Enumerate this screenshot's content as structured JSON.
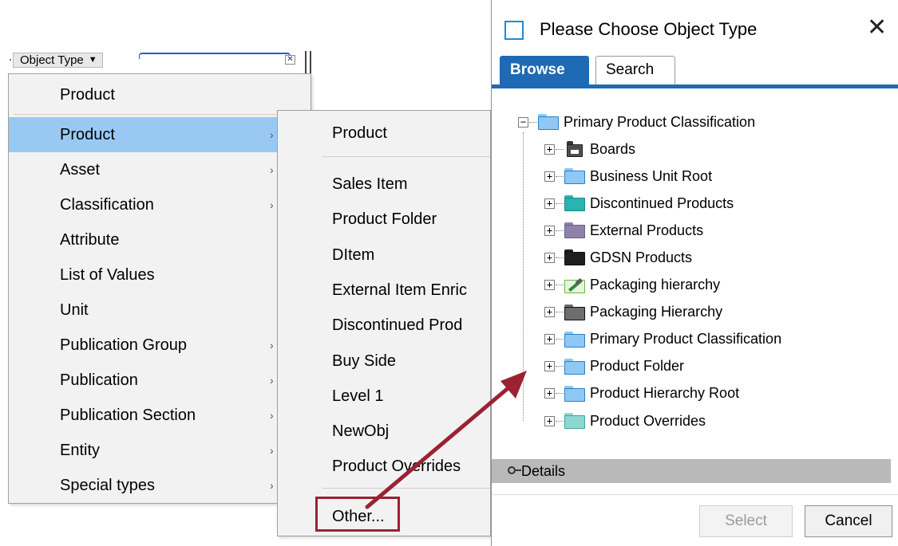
{
  "object_type_filter": {
    "label": "Object Type",
    "caret": "▼",
    "clear": "✕"
  },
  "menu": {
    "header": "Product",
    "items": [
      {
        "label": "Product",
        "has_submenu": true,
        "highlighted": true
      },
      {
        "label": "Asset",
        "has_submenu": true
      },
      {
        "label": "Classification",
        "has_submenu": true
      },
      {
        "label": "Attribute",
        "has_submenu": false
      },
      {
        "label": "List of Values",
        "has_submenu": false
      },
      {
        "label": "Unit",
        "has_submenu": false
      },
      {
        "label": "Publication Group",
        "has_submenu": true
      },
      {
        "label": "Publication",
        "has_submenu": true
      },
      {
        "label": "Publication Section",
        "has_submenu": true
      },
      {
        "label": "Entity",
        "has_submenu": true
      },
      {
        "label": "Special types",
        "has_submenu": true
      }
    ],
    "submenu_arrow": "›"
  },
  "submenu": {
    "header": "Product",
    "items": [
      "Sales Item",
      "Product Folder",
      "DItem",
      "External Item Enric",
      "Discontinued Prod",
      "Buy Side",
      "Level 1",
      "NewObj",
      "Product Overrides"
    ],
    "other": "Other..."
  },
  "dialog": {
    "title": "Please Choose Object Type",
    "close": "✕",
    "tabs": [
      {
        "label": "Browse",
        "active": true
      },
      {
        "label": "Search",
        "active": false
      }
    ],
    "tree": {
      "root": {
        "label": "Primary Product Classification",
        "expander": "−"
      },
      "children": [
        {
          "label": "Boards",
          "icon": "boards-icon",
          "color": "#555555"
        },
        {
          "label": "Business Unit Root",
          "icon": "folder-icon",
          "color": "#8fc8f4"
        },
        {
          "label": "Discontinued Products",
          "icon": "folder-icon",
          "color": "#2ab3b0"
        },
        {
          "label": "External Products",
          "icon": "folder-icon",
          "color": "#8f82a8"
        },
        {
          "label": "GDSN Products",
          "icon": "folder-icon",
          "color": "#1e1e1e"
        },
        {
          "label": "Packaging hierarchy",
          "icon": "packaging-edit-icon",
          "color": "#6bb84a"
        },
        {
          "label": "Packaging Hierarchy",
          "icon": "folder-icon",
          "color": "#6e6e6e"
        },
        {
          "label": "Primary Product Classification",
          "icon": "folder-icon",
          "color": "#8fc8f4"
        },
        {
          "label": "Product Folder",
          "icon": "folder-icon",
          "color": "#8fc8f4"
        },
        {
          "label": "Product Hierarchy Root",
          "icon": "folder-icon",
          "color": "#8fc8f4"
        },
        {
          "label": "Product Overrides",
          "icon": "folder-icon",
          "color": "#8fd6d0"
        }
      ],
      "expander": "+"
    },
    "details_label": "Details",
    "buttons": {
      "select": "Select",
      "cancel": "Cancel"
    }
  },
  "colors": {
    "highlight": "#99c9f3",
    "browse_tab": "#1f6ab5",
    "annotation": "#9b2232"
  }
}
